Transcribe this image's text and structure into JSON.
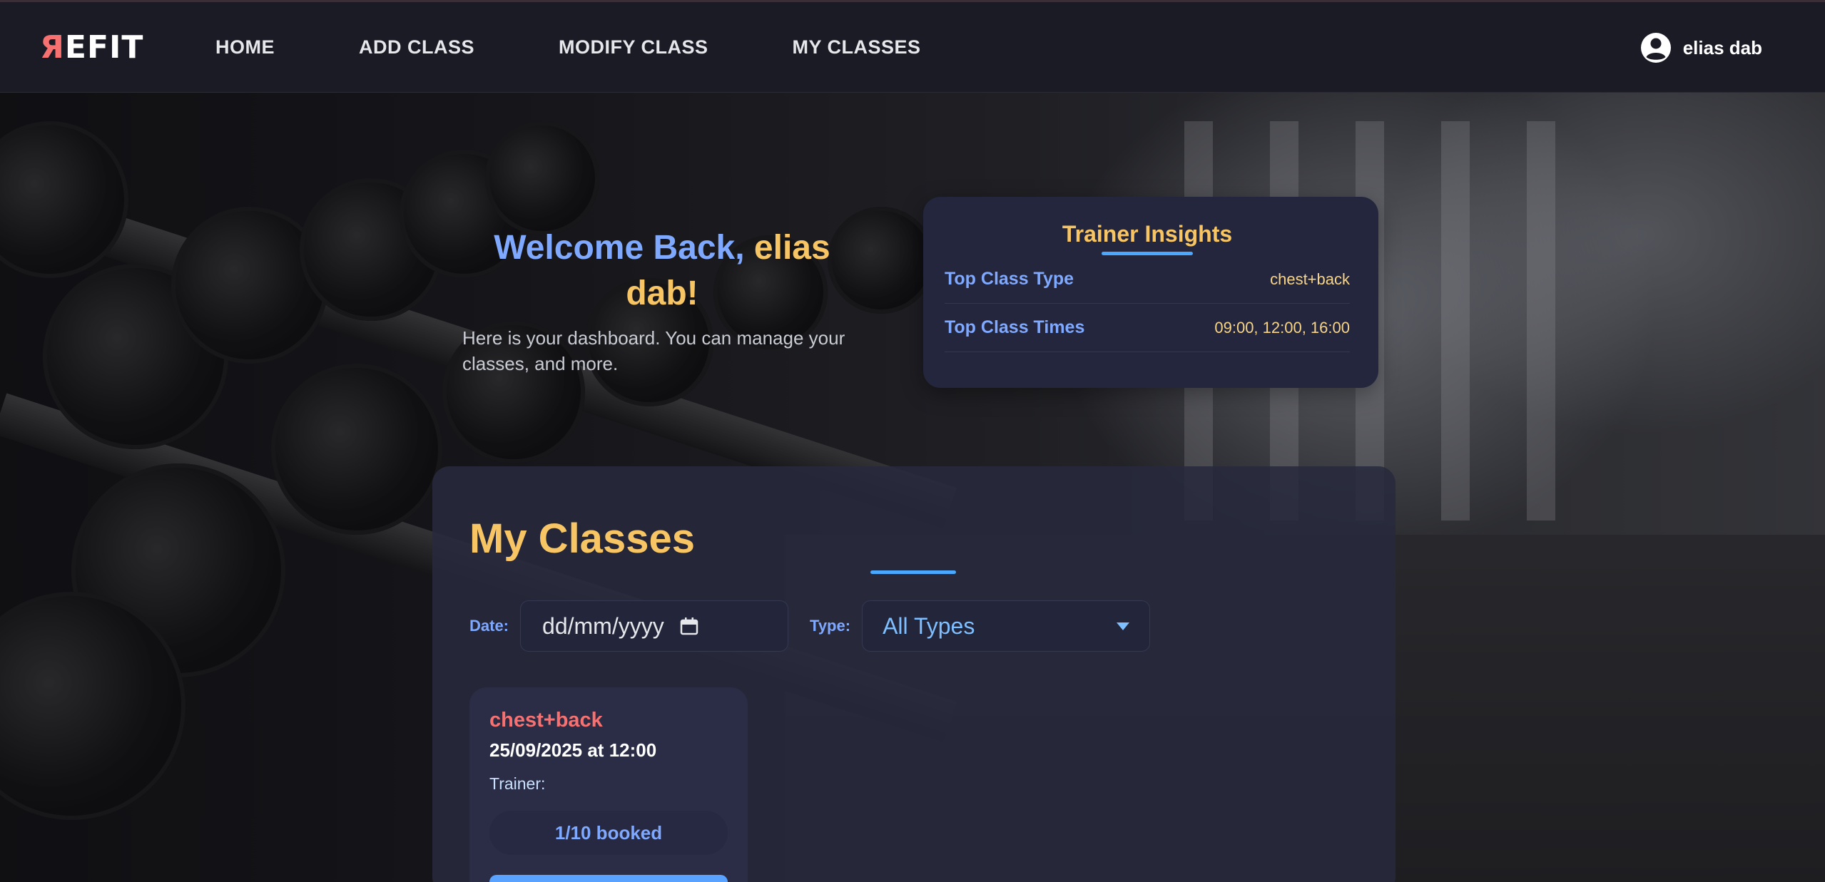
{
  "navbar": {
    "logo_accent": "Я",
    "logo_rest": "EFIT",
    "links": [
      "HOME",
      "ADD CLASS",
      "MODIFY CLASS",
      "MY CLASSES"
    ],
    "user_name": "elias dab",
    "user_icon": "user-circle-icon"
  },
  "welcome": {
    "title_part1": "Welcome Back, ",
    "title_part2": "elias dab!",
    "subtitle": "Here is your dashboard. You can manage your classes, and more."
  },
  "insights": {
    "title": "Trainer Insights",
    "rows": [
      {
        "label": "Top Class Type",
        "value": "chest+back"
      },
      {
        "label": "Top Class Times",
        "value": "09:00, 12:00, 16:00"
      }
    ]
  },
  "my_classes": {
    "title": "My Classes",
    "filters": {
      "date_label": "Date:",
      "date_placeholder": "dd/mm/yyyy",
      "type_label": "Type:",
      "type_selected": "All Types"
    },
    "cards": [
      {
        "type": "chest+back",
        "when": "25/09/2025 at 12:00",
        "trainer_label": "Trainer:",
        "booked": "1/10 booked"
      }
    ]
  },
  "colors": {
    "accent_gold": "#f8c564",
    "accent_blue": "#7fa8ff",
    "accent_red": "#f87171",
    "navbar_bg": "#1b1b26",
    "card_bg": "#23263d"
  }
}
